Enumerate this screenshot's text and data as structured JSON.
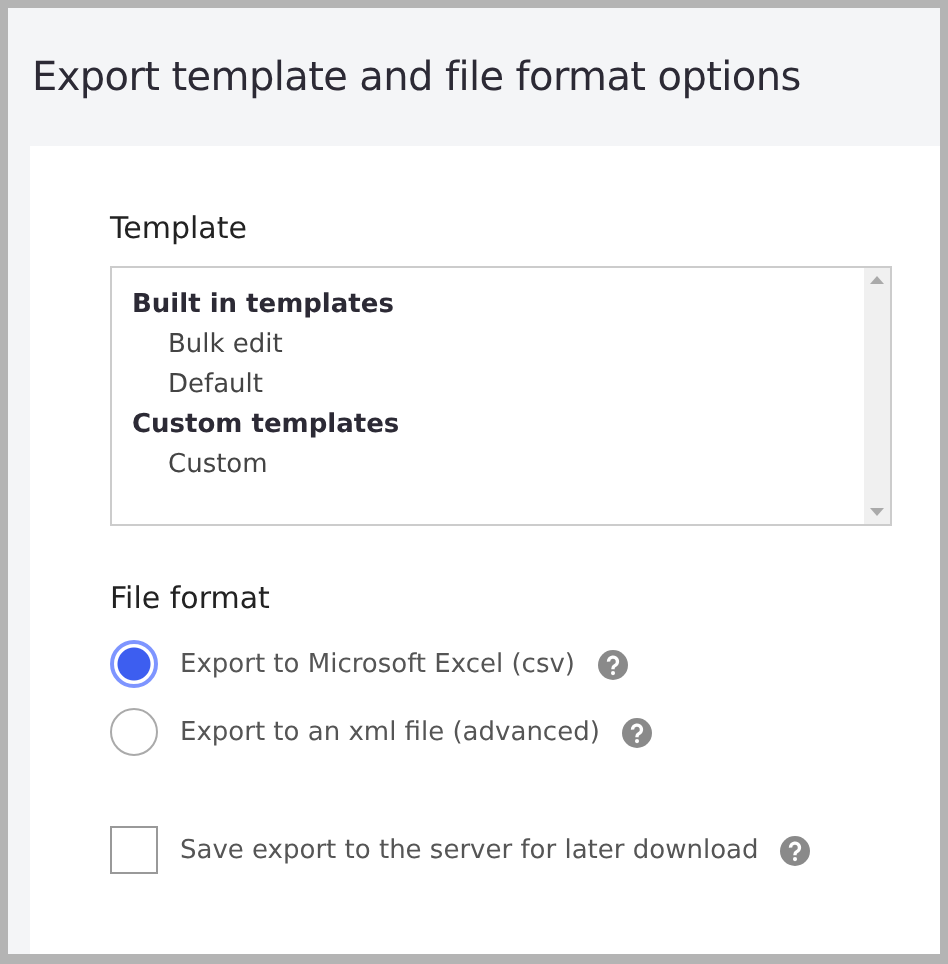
{
  "title": "Export template and file format options",
  "template": {
    "label": "Template",
    "groups": [
      {
        "label": "Built in templates",
        "children": [
          {
            "label": "Bulk edit",
            "selected": false
          },
          {
            "label": "Default",
            "selected": false
          }
        ]
      },
      {
        "label": "Custom templates",
        "children": [
          {
            "label": "Custom",
            "selected": false
          }
        ]
      }
    ]
  },
  "file_format": {
    "label": "File format",
    "options": [
      {
        "label": "Export to Microsoft Excel (csv)",
        "selected": true
      },
      {
        "label": "Export to an xml file (advanced)",
        "selected": false
      }
    ]
  },
  "save_to_server": {
    "label": "Save export to the server for later download",
    "checked": false
  }
}
